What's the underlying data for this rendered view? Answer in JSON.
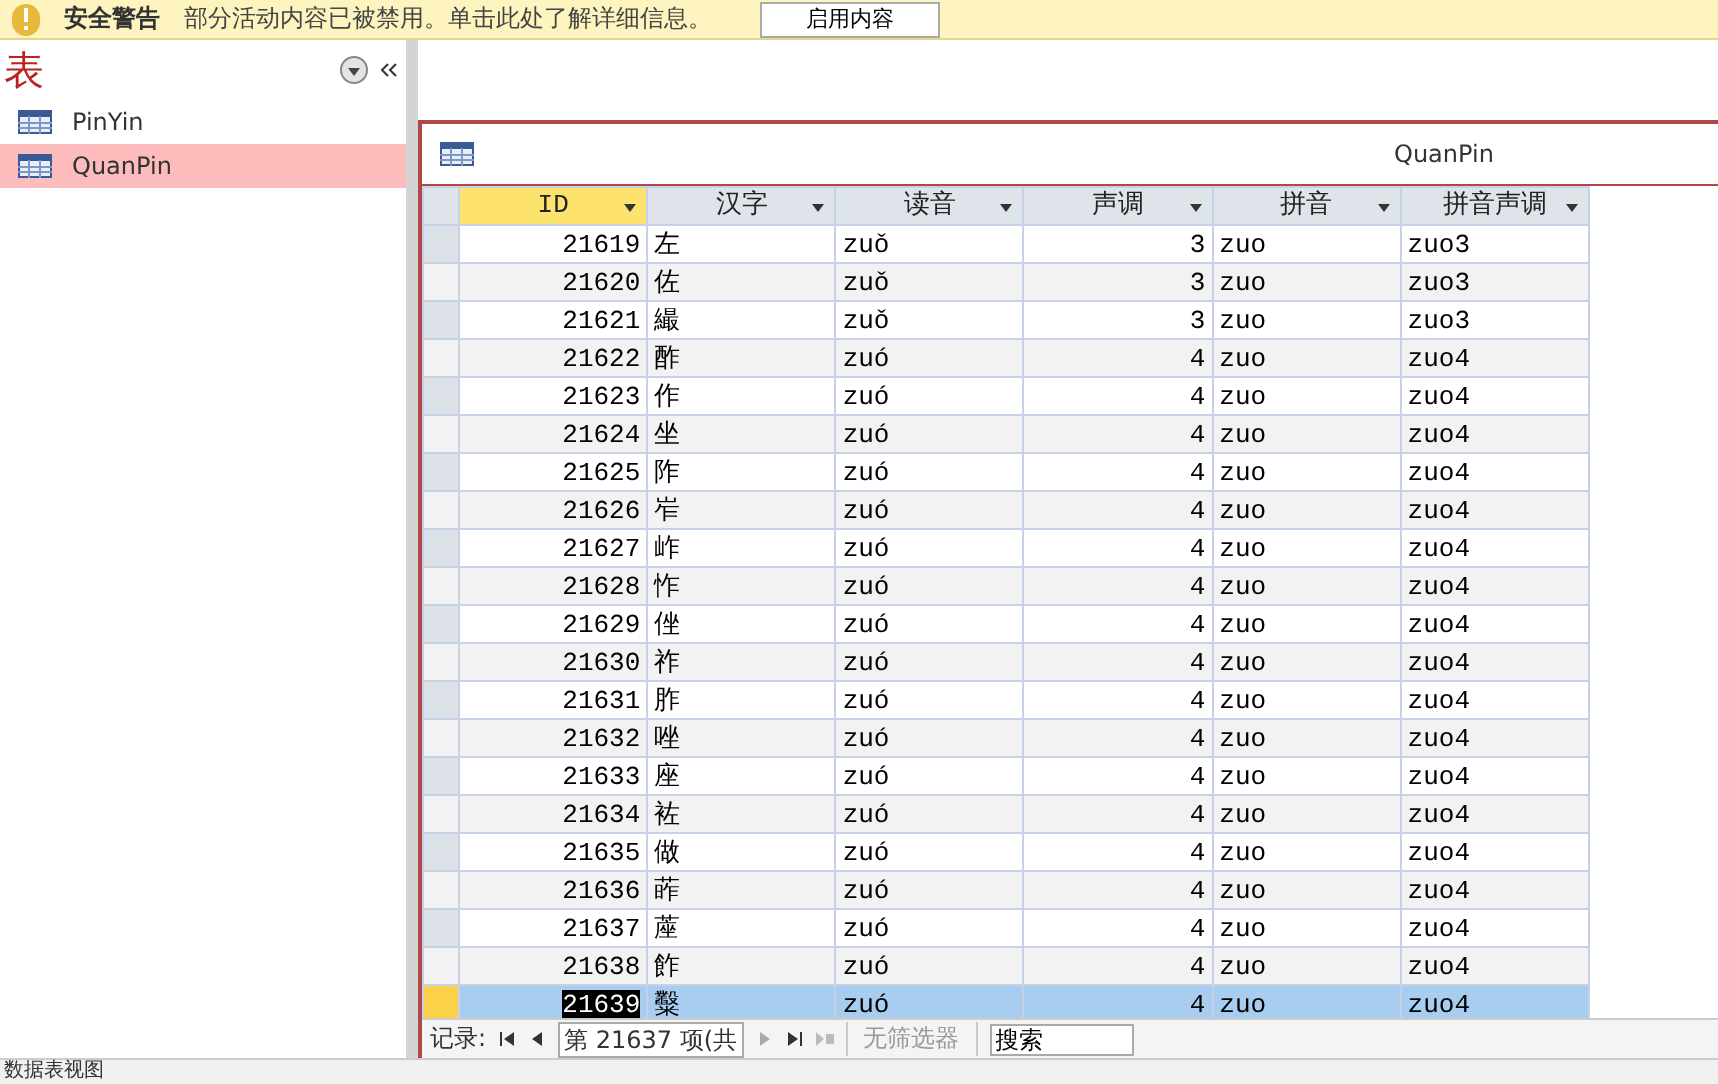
{
  "security_bar": {
    "title": "安全警告",
    "message": "部分活动内容已被禁用。单击此处了解详细信息。",
    "button": "启用内容"
  },
  "nav_pane": {
    "heading": "表",
    "items": [
      {
        "label": "PinYin",
        "selected": false
      },
      {
        "label": "QuanPin",
        "selected": true
      }
    ]
  },
  "datasheet": {
    "title": "QuanPin",
    "columns": [
      {
        "label": "ID",
        "kind": "number",
        "selected": true
      },
      {
        "label": "汉字",
        "kind": "text",
        "selected": false
      },
      {
        "label": "读音",
        "kind": "text",
        "selected": false
      },
      {
        "label": "声调",
        "kind": "number",
        "selected": false
      },
      {
        "label": "拼音",
        "kind": "text",
        "selected": false
      },
      {
        "label": "拼音声调",
        "kind": "text",
        "selected": false
      }
    ],
    "rows": [
      {
        "cells": [
          "21619",
          "左",
          "zuǒ",
          "3",
          "zuo",
          "zuo3"
        ],
        "selected": false
      },
      {
        "cells": [
          "21620",
          "佐",
          "zuǒ",
          "3",
          "zuo",
          "zuo3"
        ],
        "selected": false
      },
      {
        "cells": [
          "21621",
          "繓",
          "zuǒ",
          "3",
          "zuo",
          "zuo3"
        ],
        "selected": false
      },
      {
        "cells": [
          "21622",
          "酢",
          "zuó",
          "4",
          "zuo",
          "zuo4"
        ],
        "selected": false
      },
      {
        "cells": [
          "21623",
          "作",
          "zuó",
          "4",
          "zuo",
          "zuo4"
        ],
        "selected": false
      },
      {
        "cells": [
          "21624",
          "坐",
          "zuó",
          "4",
          "zuo",
          "zuo4"
        ],
        "selected": false
      },
      {
        "cells": [
          "21625",
          "阼",
          "zuó",
          "4",
          "zuo",
          "zuo4"
        ],
        "selected": false
      },
      {
        "cells": [
          "21626",
          "岝",
          "zuó",
          "4",
          "zuo",
          "zuo4"
        ],
        "selected": false
      },
      {
        "cells": [
          "21627",
          "岞",
          "zuó",
          "4",
          "zuo",
          "zuo4"
        ],
        "selected": false
      },
      {
        "cells": [
          "21628",
          "怍",
          "zuó",
          "4",
          "zuo",
          "zuo4"
        ],
        "selected": false
      },
      {
        "cells": [
          "21629",
          "侳",
          "zuó",
          "4",
          "zuo",
          "zuo4"
        ],
        "selected": false
      },
      {
        "cells": [
          "21630",
          "祚",
          "zuó",
          "4",
          "zuo",
          "zuo4"
        ],
        "selected": false
      },
      {
        "cells": [
          "21631",
          "胙",
          "zuó",
          "4",
          "zuo",
          "zuo4"
        ],
        "selected": false
      },
      {
        "cells": [
          "21632",
          "唑",
          "zuó",
          "4",
          "zuo",
          "zuo4"
        ],
        "selected": false
      },
      {
        "cells": [
          "21633",
          "座",
          "zuó",
          "4",
          "zuo",
          "zuo4"
        ],
        "selected": false
      },
      {
        "cells": [
          "21634",
          "袏",
          "zuó",
          "4",
          "zuo",
          "zuo4"
        ],
        "selected": false
      },
      {
        "cells": [
          "21635",
          "做",
          "zuó",
          "4",
          "zuo",
          "zuo4"
        ],
        "selected": false
      },
      {
        "cells": [
          "21636",
          "葃",
          "zuó",
          "4",
          "zuo",
          "zuo4"
        ],
        "selected": false
      },
      {
        "cells": [
          "21637",
          "蓙",
          "zuó",
          "4",
          "zuo",
          "zuo4"
        ],
        "selected": false
      },
      {
        "cells": [
          "21638",
          "飵",
          "zuó",
          "4",
          "zuo",
          "zuo4"
        ],
        "selected": false
      },
      {
        "cells": [
          "21639",
          "糳",
          "zuó",
          "4",
          "zuo",
          "zuo4"
        ],
        "selected": true
      }
    ]
  },
  "record_nav": {
    "label": "记录:",
    "position": "第 21637 项(共",
    "filter": {
      "label": "无筛选器",
      "disabled": true
    },
    "search": {
      "placeholder": "搜索"
    }
  },
  "status_bar": {
    "text": "数据表视图"
  }
}
